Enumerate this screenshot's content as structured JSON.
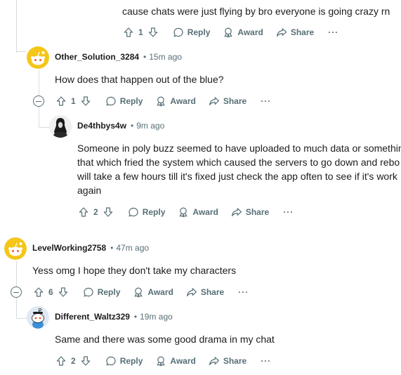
{
  "comments": [
    {
      "body_lines": [
        "cause chats were just flying by bro everyone is going crazy rn"
      ],
      "votes": "1",
      "reply_label": "Reply",
      "award_label": "Award",
      "share_label": "Share",
      "more_label": "···"
    },
    {
      "username": "Other_Solution_3284",
      "time": "15m ago",
      "body_lines": [
        "How does that happen out of the blue?"
      ],
      "votes": "1",
      "reply_label": "Reply",
      "award_label": "Award",
      "share_label": "Share",
      "more_label": "···"
    },
    {
      "username": "De4thbys4w",
      "time": "9m ago",
      "body_lines": [
        "Someone in poly buzz seemed to have uploaded to much data or somethin",
        "that which fried the system which caused the servers to go down and rebo",
        "will take a few hours till it's fixed just check the app often to see if it's work",
        "again"
      ],
      "votes": "2",
      "reply_label": "Reply",
      "award_label": "Award",
      "share_label": "Share",
      "more_label": "···"
    },
    {
      "username": "LevelWorking2758",
      "time": "47m ago",
      "body_lines": [
        "Yess omg I hope they don't take my characters"
      ],
      "votes": "6",
      "reply_label": "Reply",
      "award_label": "Award",
      "share_label": "Share",
      "more_label": "···"
    },
    {
      "username": "Different_Waltz329",
      "time": "19m ago",
      "body_lines": [
        "Same and there was some good drama in my chat"
      ],
      "votes": "2",
      "reply_label": "Reply",
      "award_label": "Award",
      "share_label": "Share",
      "more_label": "···"
    }
  ],
  "colors": {
    "meta": "#576f76",
    "thread_line": "#d9dde0",
    "snoo_yellow": "#f5c518",
    "snoo_blue": "#3d8ed8"
  }
}
